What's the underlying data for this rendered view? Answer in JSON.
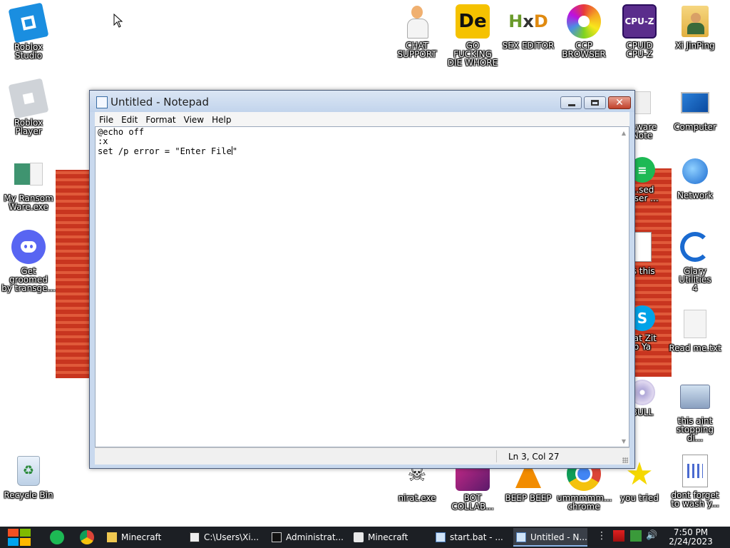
{
  "desktop": {
    "icons_left": [
      {
        "label": "Roblox\nStudio",
        "icon": "roblox-studio-icon"
      },
      {
        "label": "Roblox\nPlayer",
        "icon": "roblox-player-icon"
      },
      {
        "label": "My Ransom\nWare.exe",
        "icon": "ransomware-icon"
      },
      {
        "label": "Get groomed\nby transge...",
        "icon": "discord-icon"
      },
      {
        "label": "Recycle Bin",
        "icon": "recycle-bin-icon"
      }
    ],
    "icons_top": [
      {
        "label": "CHAT\nSUPPORT",
        "icon": "doctor-icon"
      },
      {
        "label": "GO FUCKING\nDIE WHORE",
        "icon": "de-icon"
      },
      {
        "label": "SEX EDITOR",
        "icon": "hxd-icon"
      },
      {
        "label": "CCP\nBROWSER",
        "icon": "colorful-browser-icon"
      },
      {
        "label": "CPUID\nCPU-Z",
        "icon": "cpuz-icon"
      },
      {
        "label": "Xi JinPing",
        "icon": "user-folder-icon"
      }
    ],
    "icons_right": [
      {
        "label": "Computer",
        "icon": "computer-icon"
      },
      {
        "label": "Network",
        "icon": "network-icon"
      },
      {
        "label": "Glary Utilities\n4",
        "icon": "glary-icon"
      },
      {
        "label": "Read me.txt",
        "icon": "text-file-icon"
      },
      {
        "label": "this aint\nstopping di...",
        "icon": "computer-search-icon"
      },
      {
        "label": "dont forget\nto wash y...",
        "icon": "document-icon"
      }
    ],
    "icons_partial": [
      {
        "label": "...ware\nNote",
        "icon": "note-icon"
      },
      {
        "label": "...sed\n...ser ...",
        "icon": "spotify-icon"
      },
      {
        "label": "is this",
        "icon": "file-icon"
      },
      {
        "label": "hat Zit\no Ya",
        "icon": "skype-icon"
      },
      {
        "label": "BULL",
        "icon": "disc-icon"
      }
    ],
    "icons_bottom": [
      {
        "label": "nirat.exe",
        "icon": "skull-icon"
      },
      {
        "label": "BOT\nCOLLAB...",
        "icon": "bot-icon"
      },
      {
        "label": "BEEP BEEP",
        "icon": "vlc-icon"
      },
      {
        "label": "ummmmm...\nchrome",
        "icon": "chrome-icon"
      },
      {
        "label": "you tried",
        "icon": "star-icon"
      }
    ]
  },
  "notepad": {
    "title": "Untitled - Notepad",
    "menu": [
      "File",
      "Edit",
      "Format",
      "View",
      "Help"
    ],
    "lines": [
      "@echo off",
      ":x",
      "set /p error = \"Enter File"
    ],
    "line3_tail": "\"",
    "status": "Ln 3, Col 27"
  },
  "taskbar": {
    "items": [
      {
        "label": "Minecraft",
        "icon": "folder-icon"
      },
      {
        "label": "C:\\Users\\Xi...",
        "icon": "7zip-icon"
      },
      {
        "label": "Administrat...",
        "icon": "cmd-icon"
      },
      {
        "label": "Minecraft",
        "icon": "java-icon"
      },
      {
        "label": "start.bat - ...",
        "icon": "notepad-icon"
      },
      {
        "label": "Untitled - N...",
        "icon": "notepad-icon"
      }
    ],
    "time": "7:50 PM",
    "date": "2/24/2023"
  },
  "colors": {
    "taskbar": "#1c1f24",
    "window_frame": "#c9d9ee",
    "bg_accent": "#d0402a"
  }
}
